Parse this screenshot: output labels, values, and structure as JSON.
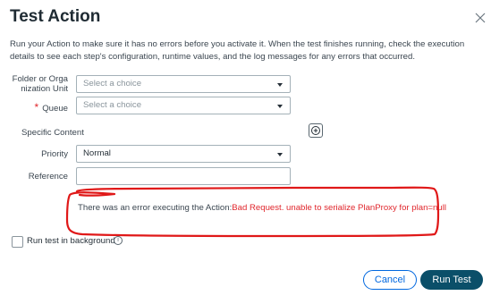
{
  "dialog": {
    "title": "Test Action",
    "description": "Run your Action to make sure it has no errors before you activate it. When the test finishes running, check the execution details to see each step's configuration, runtime values, and the log messages for any errors that occurred."
  },
  "form": {
    "folder": {
      "label": "Folder or Organization Unit",
      "placeholder": "Select a choice"
    },
    "queue": {
      "label": "Queue",
      "required_marker": "*",
      "placeholder": "Select a choice"
    },
    "specific_content": {
      "label": "Specific Content"
    },
    "priority": {
      "label": "Priority",
      "value": "Normal"
    },
    "reference": {
      "label": "Reference",
      "value": ""
    }
  },
  "error": {
    "prefix": "There was an error executing the Action:",
    "message": "Bad Request. unable to serialize PlanProxy for plan=null"
  },
  "options": {
    "run_in_background_label": "Run test in background",
    "info_glyph": "i"
  },
  "buttons": {
    "cancel": "Cancel",
    "run": "Run Test"
  },
  "colors": {
    "accent": "#0067df",
    "primary_button": "#0b4f69",
    "error": "#e0262c",
    "annotation": "#e01818"
  },
  "icons": {
    "close": "close-icon",
    "add": "plus-circle-icon",
    "info": "info-icon",
    "dropdown": "chevron-down-icon"
  }
}
